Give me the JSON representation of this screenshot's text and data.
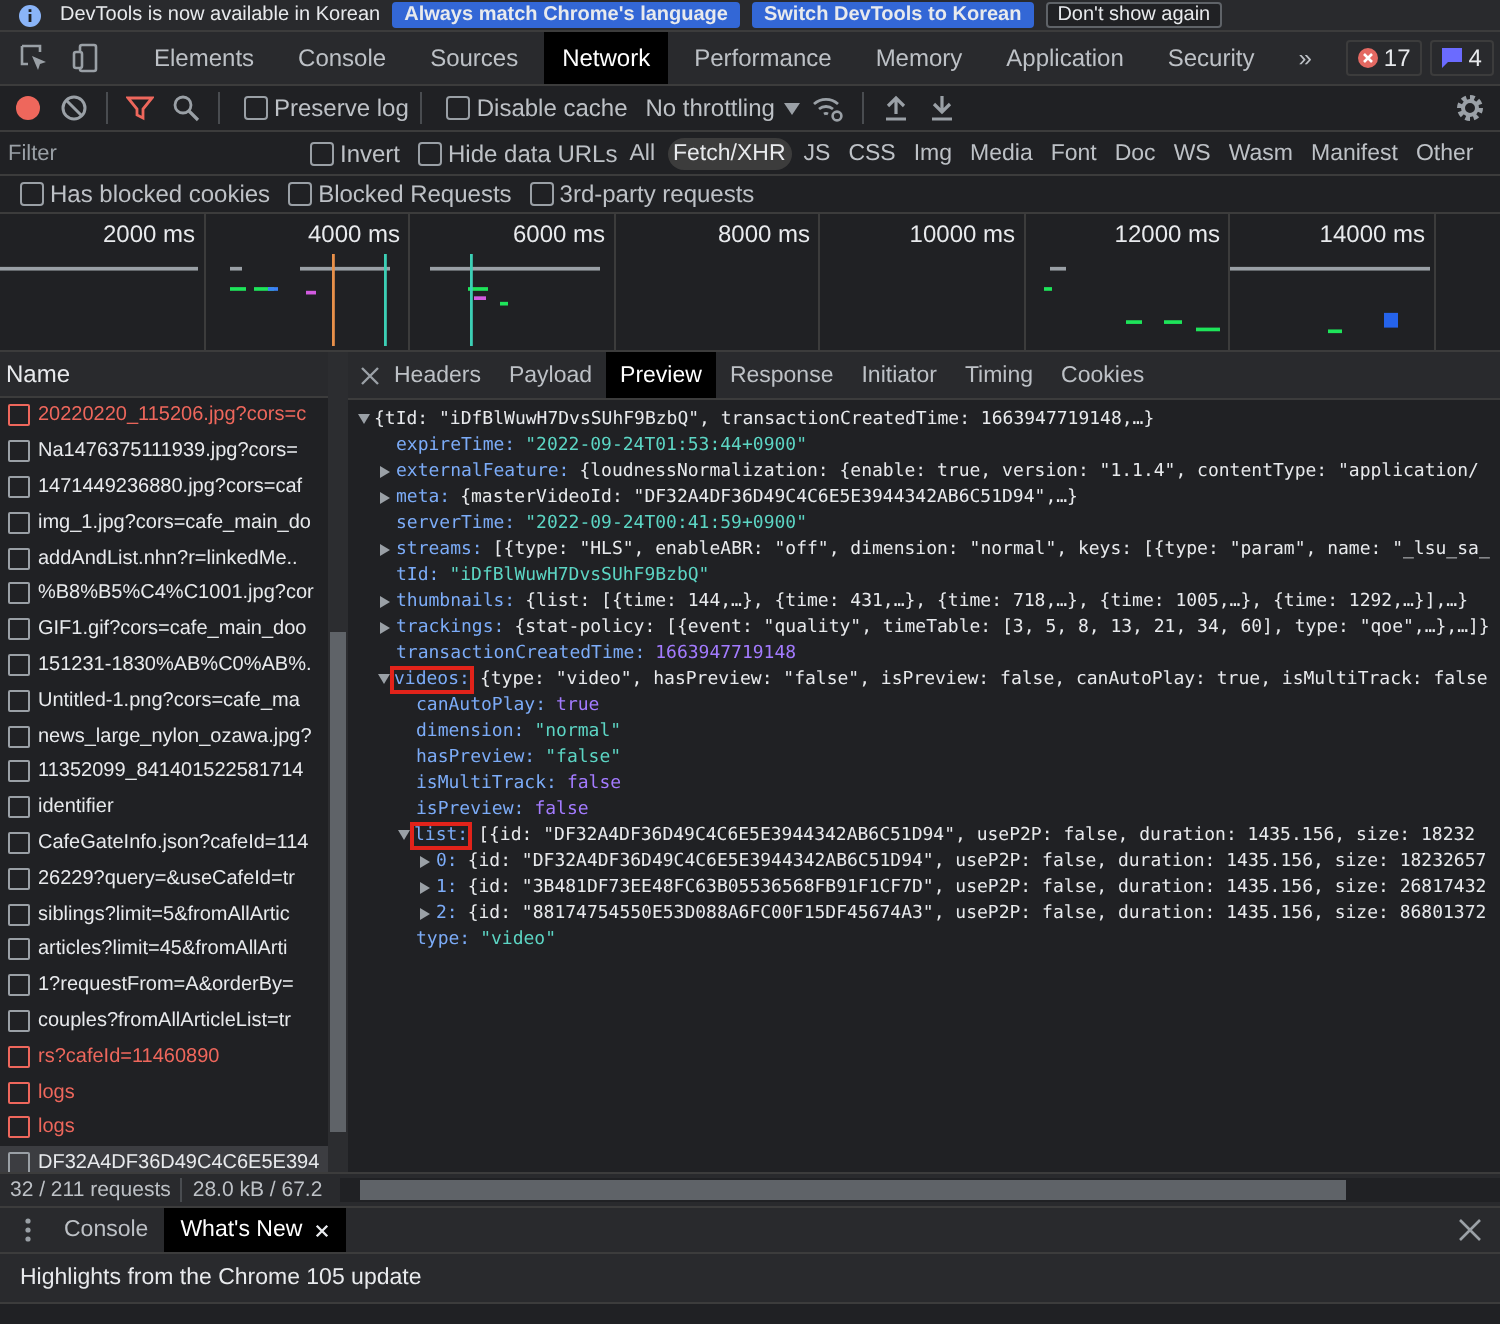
{
  "banner": {
    "message": "DevTools is now available in Korean",
    "buttons": [
      {
        "label": "Always match Chrome's language",
        "kind": "primary"
      },
      {
        "label": "Switch DevTools to Korean",
        "kind": "primary"
      },
      {
        "label": "Don't show again",
        "kind": "plain"
      }
    ]
  },
  "main_tabs": [
    {
      "label": "Elements",
      "selected": false
    },
    {
      "label": "Console",
      "selected": false
    },
    {
      "label": "Sources",
      "selected": false
    },
    {
      "label": "Network",
      "selected": true
    },
    {
      "label": "Performance",
      "selected": false
    },
    {
      "label": "Memory",
      "selected": false
    },
    {
      "label": "Application",
      "selected": false
    },
    {
      "label": "Security",
      "selected": false
    }
  ],
  "more_tabs": "»",
  "badges": {
    "errors": "17",
    "messages": "4"
  },
  "toolbar": {
    "recording": true,
    "filter_active": true,
    "options": [
      {
        "label": "Preserve log",
        "checked": false
      },
      {
        "label": "Disable cache",
        "checked": false
      }
    ],
    "throttling": "No throttling"
  },
  "filter": {
    "placeholder": "Filter",
    "options": [
      {
        "label": "Invert",
        "checked": false
      },
      {
        "label": "Hide data URLs",
        "checked": false
      }
    ],
    "types": [
      {
        "label": "All",
        "selected": false
      },
      {
        "label": "Fetch/XHR",
        "selected": true
      },
      {
        "label": "JS",
        "selected": false
      },
      {
        "label": "CSS",
        "selected": false
      },
      {
        "label": "Img",
        "selected": false
      },
      {
        "label": "Media",
        "selected": false
      },
      {
        "label": "Font",
        "selected": false
      },
      {
        "label": "Doc",
        "selected": false
      },
      {
        "label": "WS",
        "selected": false
      },
      {
        "label": "Wasm",
        "selected": false
      },
      {
        "label": "Manifest",
        "selected": false
      },
      {
        "label": "Other",
        "selected": false
      }
    ]
  },
  "request_filters": [
    {
      "label": "Has blocked cookies",
      "checked": false
    },
    {
      "label": "Blocked Requests",
      "checked": false
    },
    {
      "label": "3rd-party requests",
      "checked": false
    }
  ],
  "timeline": {
    "ticks": [
      "2000 ms",
      "4000 ms",
      "6000 ms",
      "8000 ms",
      "10000 ms",
      "12000 ms",
      "14000 ms"
    ]
  },
  "requests": {
    "column": "Name",
    "rows": [
      {
        "name": "20220220_115206.jpg?cors=c",
        "failed": true,
        "selected": false
      },
      {
        "name": "Na1476375111939.jpg?cors=",
        "failed": false,
        "selected": false
      },
      {
        "name": "1471449236880.jpg?cors=caf",
        "failed": false,
        "selected": false
      },
      {
        "name": "img_1.jpg?cors=cafe_main_do",
        "failed": false,
        "selected": false
      },
      {
        "name": "addAndList.nhn?r=linkedMe..",
        "failed": false,
        "selected": false
      },
      {
        "name": "%B8%B5%C4%C1001.jpg?cor",
        "failed": false,
        "selected": false
      },
      {
        "name": "GIF1.gif?cors=cafe_main_doo",
        "failed": false,
        "selected": false
      },
      {
        "name": "151231-1830%AB%C0%AB%.",
        "failed": false,
        "selected": false
      },
      {
        "name": "Untitled-1.png?cors=cafe_ma",
        "failed": false,
        "selected": false
      },
      {
        "name": "news_large_nylon_ozawa.jpg?",
        "failed": false,
        "selected": false
      },
      {
        "name": "11352099_841401522581714",
        "failed": false,
        "selected": false
      },
      {
        "name": "identifier",
        "failed": false,
        "selected": false
      },
      {
        "name": "CafeGateInfo.json?cafeId=114",
        "failed": false,
        "selected": false
      },
      {
        "name": "26229?query=&useCafeId=tr",
        "failed": false,
        "selected": false
      },
      {
        "name": "siblings?limit=5&fromAllArtic",
        "failed": false,
        "selected": false
      },
      {
        "name": "articles?limit=45&fromAllArti",
        "failed": false,
        "selected": false
      },
      {
        "name": "1?requestFrom=A&orderBy=",
        "failed": false,
        "selected": false
      },
      {
        "name": "couples?fromAllArticleList=tr",
        "failed": false,
        "selected": false
      },
      {
        "name": "rs?cafeId=11460890",
        "failed": true,
        "selected": false
      },
      {
        "name": "logs",
        "failed": true,
        "selected": false
      },
      {
        "name": "logs",
        "failed": true,
        "selected": false
      },
      {
        "name": "DF32A4DF36D49C4C6E5E394",
        "failed": false,
        "selected": true
      }
    ]
  },
  "detail_tabs": [
    {
      "label": "Headers",
      "selected": false
    },
    {
      "label": "Payload",
      "selected": false
    },
    {
      "label": "Preview",
      "selected": true
    },
    {
      "label": "Response",
      "selected": false
    },
    {
      "label": "Initiator",
      "selected": false
    },
    {
      "label": "Timing",
      "selected": false
    },
    {
      "label": "Cookies",
      "selected": false
    }
  ],
  "preview": {
    "value": "{tId: \"iDfBlWuwH7DvsSUhF9BzbQ\", transactionCreatedTime: 1663947719148,…}",
    "kind": "object",
    "expanded": true,
    "children": [
      {
        "key": "expireTime:",
        "value": "\"2022-09-24T01:53:44+0900\"",
        "kind": "string"
      },
      {
        "key": "externalFeature:",
        "value": "{loudnessNormalization: {enable: true, version: \"1.1.4\", contentType: \"application/",
        "kind": "object",
        "expanded": false
      },
      {
        "key": "meta:",
        "value": "{masterVideoId: \"DF32A4DF36D49C4C6E5E3944342AB6C51D94\",…}",
        "kind": "object",
        "expanded": false
      },
      {
        "key": "serverTime:",
        "value": "\"2022-09-24T00:41:59+0900\"",
        "kind": "string"
      },
      {
        "key": "streams:",
        "value": "[{type: \"HLS\", enableABR: \"off\", dimension: \"normal\", keys: [{type: \"param\", name: \"_lsu_sa_",
        "kind": "object",
        "expanded": false
      },
      {
        "key": "tId:",
        "value": "\"iDfBlWuwH7DvsSUhF9BzbQ\"",
        "kind": "string"
      },
      {
        "key": "thumbnails:",
        "value": "{list: [{time: 144,…}, {time: 431,…}, {time: 718,…}, {time: 1005,…}, {time: 1292,…}],…}",
        "kind": "object",
        "expanded": false
      },
      {
        "key": "trackings:",
        "value": "{stat-policy: [{event: \"quality\", timeTable: [3, 5, 8, 13, 21, 34, 60], type: \"qoe\",…},…]}",
        "kind": "object",
        "expanded": false
      },
      {
        "key": "transactionCreatedTime:",
        "value": "1663947719148",
        "kind": "number"
      },
      {
        "key": "videos:",
        "value": "{type: \"video\", hasPreview: \"false\", isPreview: false, canAutoPlay: true, isMultiTrack: false",
        "kind": "object",
        "expanded": true,
        "highlighted": true,
        "children": [
          {
            "key": "canAutoPlay:",
            "value": "true",
            "kind": "boolean"
          },
          {
            "key": "dimension:",
            "value": "\"normal\"",
            "kind": "string"
          },
          {
            "key": "hasPreview:",
            "value": "\"false\"",
            "kind": "string"
          },
          {
            "key": "isMultiTrack:",
            "value": "false",
            "kind": "boolean"
          },
          {
            "key": "isPreview:",
            "value": "false",
            "kind": "boolean"
          },
          {
            "key": "list:",
            "value": "[{id: \"DF32A4DF36D49C4C6E5E3944342AB6C51D94\", useP2P: false, duration: 1435.156, size: 18232",
            "kind": "object",
            "expanded": true,
            "highlighted": true,
            "children": [
              {
                "key": "0:",
                "value": "{id: \"DF32A4DF36D49C4C6E5E3944342AB6C51D94\", useP2P: false, duration: 1435.156, size: 18232657",
                "kind": "object",
                "expanded": false
              },
              {
                "key": "1:",
                "value": "{id: \"3B481DF73EE48FC63B05536568FB91F1CF7D\", useP2P: false, duration: 1435.156, size: 26817432",
                "kind": "object",
                "expanded": false
              },
              {
                "key": "2:",
                "value": "{id: \"88174754550E53D088A6FC00F15DF45674A3\", useP2P: false, duration: 1435.156, size: 86801372",
                "kind": "object",
                "expanded": false
              }
            ]
          },
          {
            "key": "type:",
            "value": "\"video\"",
            "kind": "string"
          }
        ]
      }
    ]
  },
  "status": {
    "requests": "32 / 211 requests",
    "transferred": "28.0 kB / 67.2"
  },
  "drawer_tabs": [
    {
      "label": "Console",
      "selected": false,
      "closable": false
    },
    {
      "label": "What's New",
      "selected": true,
      "closable": true
    }
  ],
  "whats_new": {
    "heading": "Highlights from the Chrome 105 update"
  }
}
